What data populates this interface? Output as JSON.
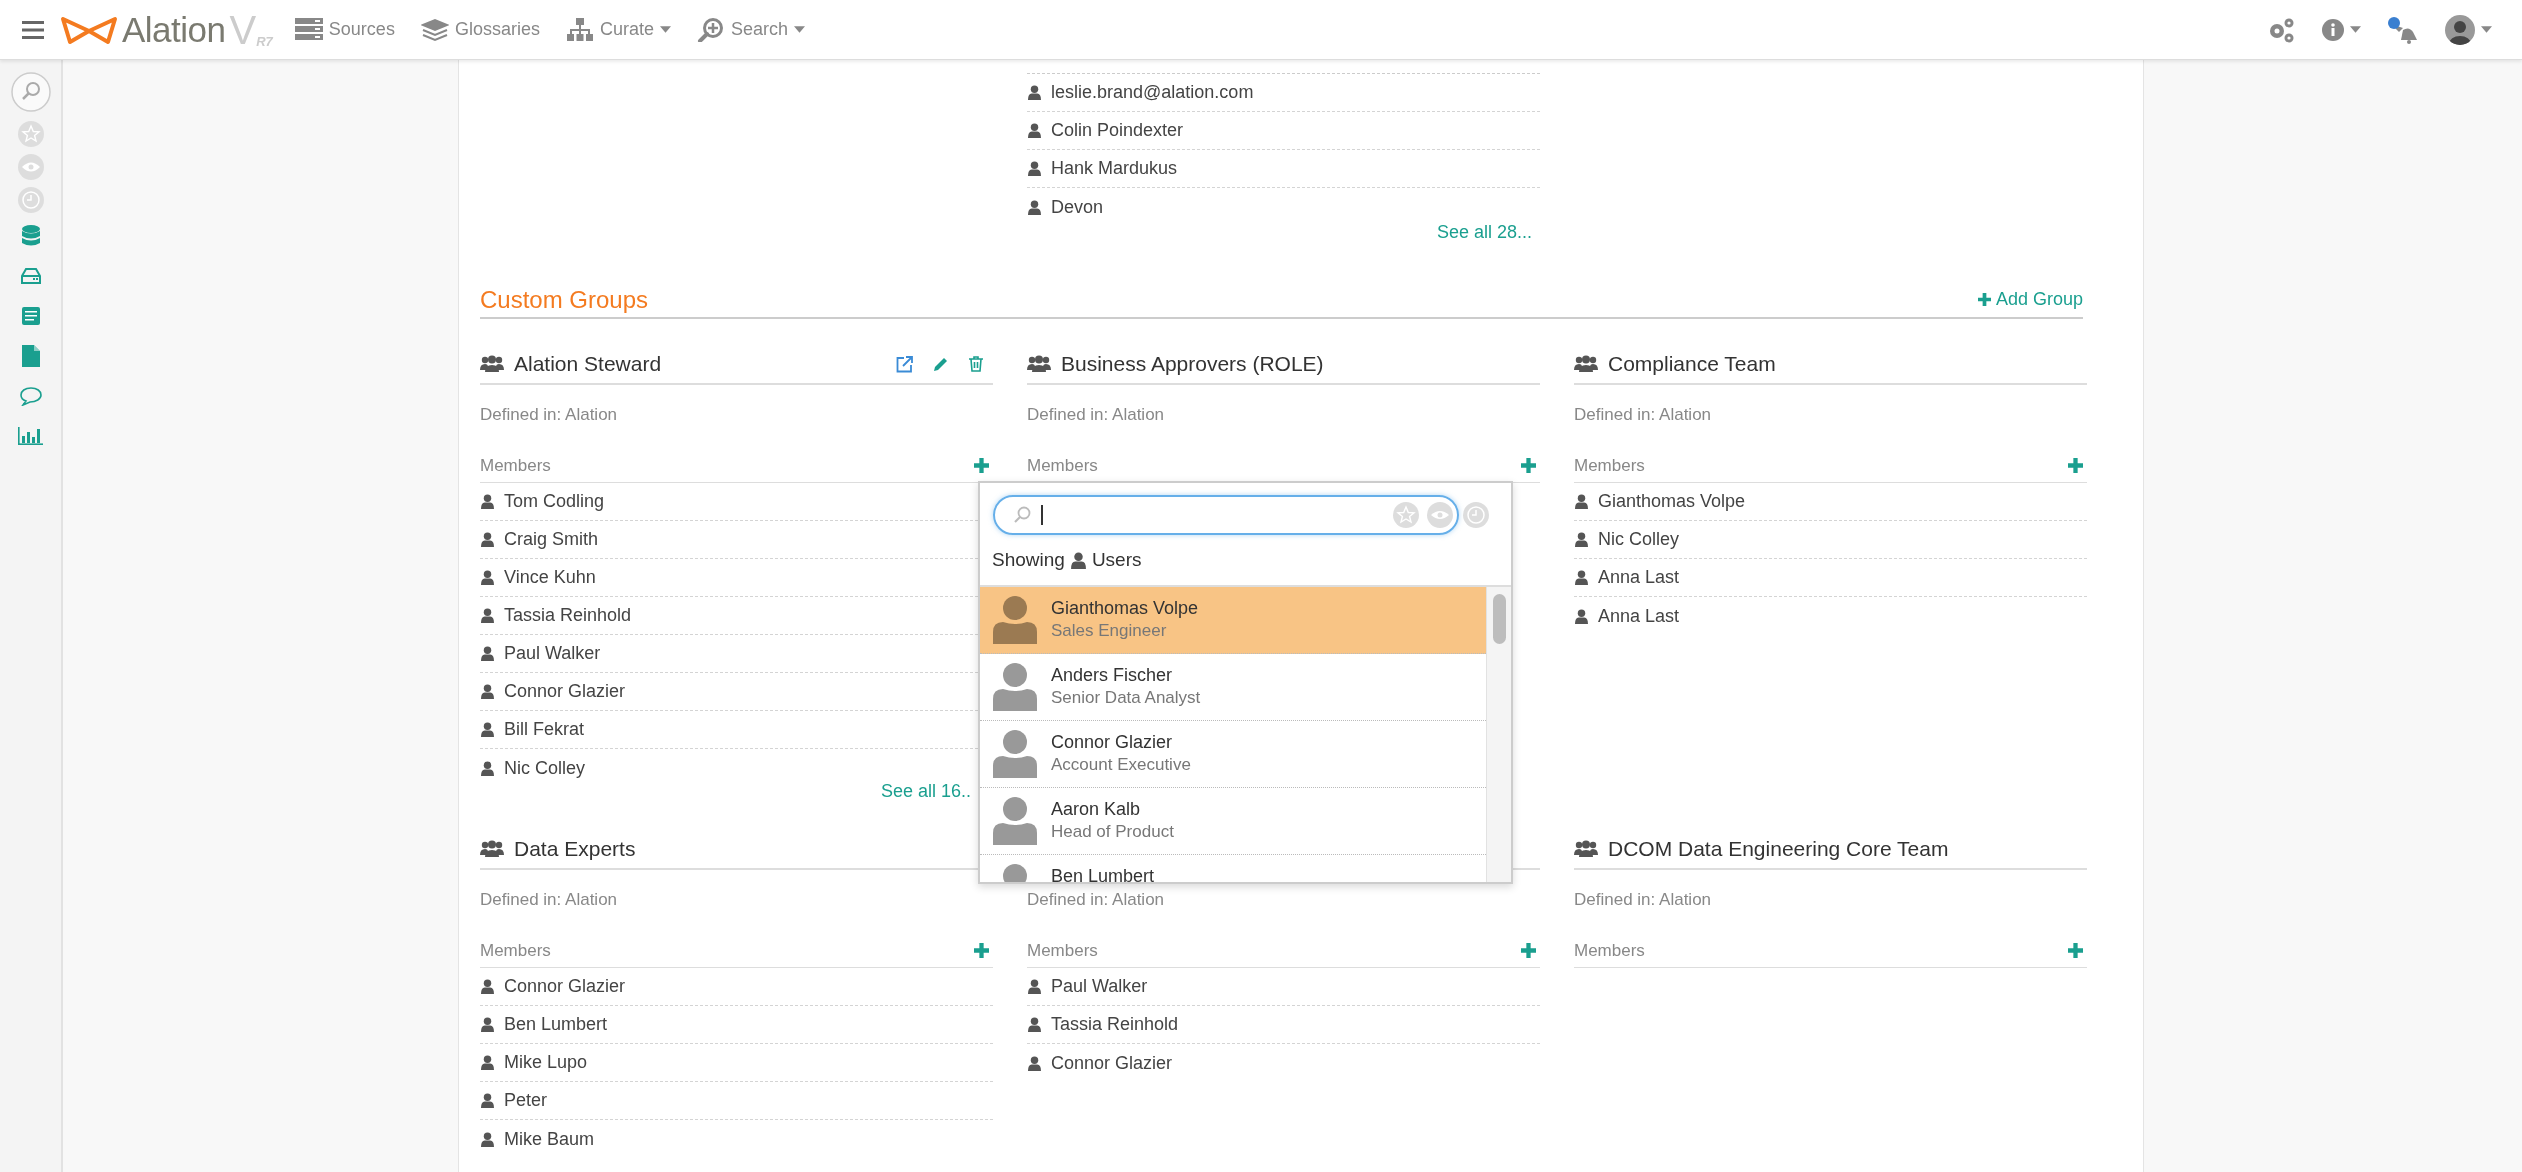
{
  "top_bar": {
    "logo": {
      "name": "Alation",
      "version": "V",
      "release": "R7"
    },
    "nav": [
      {
        "label": "Sources",
        "has_menu": false
      },
      {
        "label": "Glossaries",
        "has_menu": false
      },
      {
        "label": "Curate",
        "has_menu": true
      },
      {
        "label": "Search",
        "has_menu": true
      }
    ],
    "notifications": {
      "unread": true
    }
  },
  "earlier_list": {
    "members": [
      "leslie.brand@alation.com",
      "Colin Poindexter",
      "Hank Mardukus",
      "Devon"
    ],
    "see_all": "See all 28..."
  },
  "custom_groups": {
    "title": "Custom Groups",
    "add_label": "Add Group",
    "groups": [
      {
        "name": "Alation Steward",
        "show_actions": true,
        "defined_in": "Defined in: Alation",
        "members_label": "Members",
        "members": [
          "Tom Codling",
          "Craig Smith",
          "Vince Kuhn",
          "Tassia Reinhold",
          "Paul Walker",
          "Connor Glazier",
          "Bill Fekrat",
          "Nic Colley"
        ],
        "see_all": "See all 16.."
      },
      {
        "name": "Business Approvers (ROLE)",
        "show_actions": false,
        "defined_in": "Defined in: Alation",
        "members_label": "Members"
      },
      {
        "name": "Compliance Team",
        "show_actions": false,
        "defined_in": "Defined in: Alation",
        "members_label": "Members",
        "members": [
          "Gianthomas Volpe",
          "Nic Colley",
          "Anna Last",
          "Anna Last"
        ]
      },
      {
        "name": "Data Experts",
        "show_actions": false,
        "defined_in": "Defined in: Alation",
        "members_label": "Members",
        "members": [
          "Connor Glazier",
          "Ben Lumbert",
          "Mike Lupo",
          "Peter",
          "Mike Baum"
        ]
      },
      {
        "defined_in": "Defined in: Alation",
        "members_label": "Members",
        "members": [
          "Paul Walker",
          "Tassia Reinhold",
          "Connor Glazier"
        ]
      },
      {
        "name": "DCOM Data Engineering Core Team",
        "show_actions": false,
        "defined_in": "Defined in: Alation",
        "members_label": "Members"
      }
    ]
  },
  "user_picker": {
    "showing_label": "Showing",
    "filter": "Users",
    "results": [
      {
        "name": "Gianthomas Volpe",
        "title": "Sales Engineer",
        "selected": true
      },
      {
        "name": "Anders Fischer",
        "title": "Senior Data Analyst",
        "selected": false
      },
      {
        "name": "Connor Glazier",
        "title": "Account Executive",
        "selected": false
      },
      {
        "name": "Aaron Kalb",
        "title": "Head of Product",
        "selected": false
      },
      {
        "name": "Ben Lumbert",
        "selected": false
      }
    ]
  }
}
